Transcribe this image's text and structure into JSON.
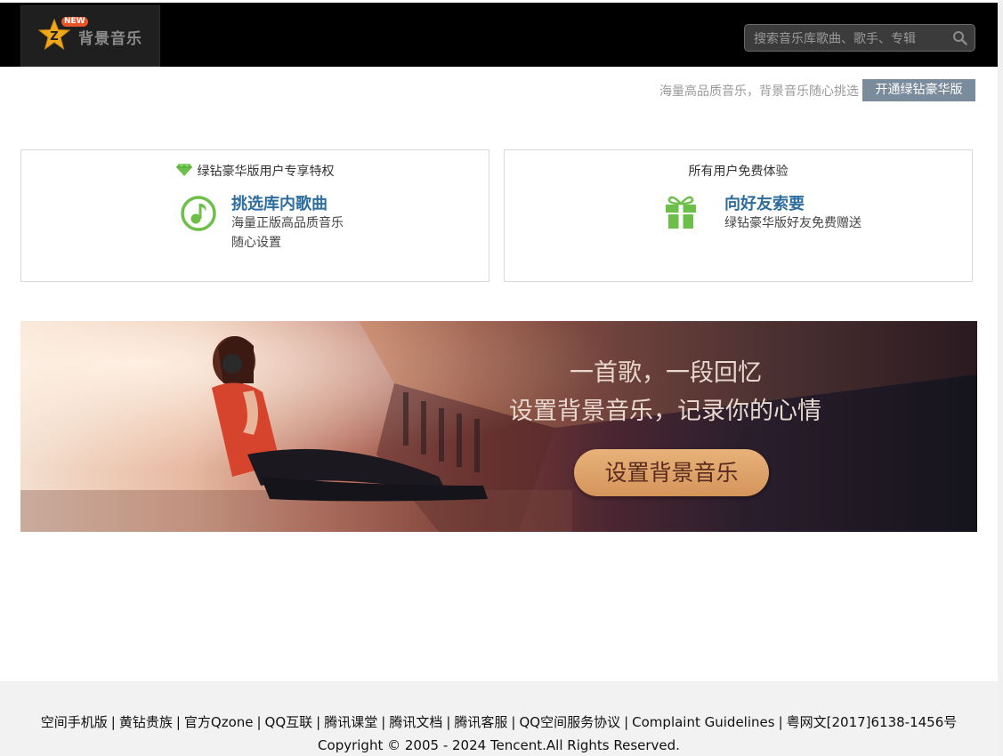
{
  "header": {
    "logo_badge": "NEW",
    "logo_text": "背景音乐",
    "search_placeholder": "搜索音乐库歌曲、歌手、专辑"
  },
  "promo": {
    "text": "海量高品质音乐，背景音乐随心挑选",
    "button_label": "开通绿钻豪华版"
  },
  "cards": [
    {
      "head": "绿钻豪华版用户专享特权",
      "title": "挑选库内歌曲",
      "desc_line1": "海量正版高品质音乐",
      "desc_line2": "随心设置"
    },
    {
      "head": "所有用户免费体验",
      "title": "向好友索要",
      "desc_line1": "绿钻豪华版好友免费赠送"
    }
  ],
  "banner": {
    "line1": "一首歌，一段回忆",
    "line2": "设置背景音乐，记录你的心情",
    "cta_label": "设置背景音乐"
  },
  "footer": {
    "links": [
      "空间手机版",
      "黄钻贵族",
      "官方Qzone",
      "QQ互联",
      "腾讯课堂",
      "腾讯文档",
      "腾讯客服",
      "QQ空间服务协议",
      "Complaint Guidelines",
      "粤网文[2017]6138-1456号"
    ],
    "copyright": "Copyright © 2005 - 2024 Tencent.All Rights Reserved."
  },
  "colors": {
    "accent_green": "#6cc04a",
    "link_blue": "#2e6e9e",
    "promo_button": "#7a8b9c",
    "cta_orange": "#d4955a"
  },
  "icons": [
    "qzone-star-logo-icon",
    "search-icon",
    "diamond-icon",
    "music-note-icon",
    "gift-icon"
  ]
}
